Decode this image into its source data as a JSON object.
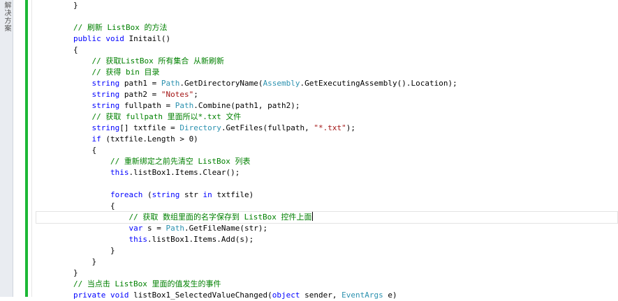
{
  "sidebar": {
    "label": "解决方案"
  },
  "colors": {
    "keyword": "#0000ff",
    "string": "#a31515",
    "comment": "#008000",
    "type": "#2b91af",
    "plain": "#000000",
    "change_bar": "#1cb836"
  },
  "editor": {
    "current_line": 19,
    "lines": [
      {
        "indent": "        ",
        "tokens": [
          [
            "plain",
            "}"
          ]
        ]
      },
      {
        "indent": "",
        "tokens": []
      },
      {
        "indent": "        ",
        "tokens": [
          [
            "cm",
            "// 刷新 ListBox 的方法"
          ]
        ]
      },
      {
        "indent": "        ",
        "tokens": [
          [
            "kw",
            "public"
          ],
          [
            "plain",
            " "
          ],
          [
            "kw",
            "void"
          ],
          [
            "plain",
            " Initail()"
          ]
        ]
      },
      {
        "indent": "        ",
        "tokens": [
          [
            "plain",
            "{"
          ]
        ]
      },
      {
        "indent": "            ",
        "tokens": [
          [
            "cm",
            "// 获取ListBox 所有集合 从新刷新"
          ]
        ]
      },
      {
        "indent": "            ",
        "tokens": [
          [
            "cm",
            "// 获得 bin 目录"
          ]
        ]
      },
      {
        "indent": "            ",
        "tokens": [
          [
            "kw",
            "string"
          ],
          [
            "plain",
            " path1 = "
          ],
          [
            "type",
            "Path"
          ],
          [
            "plain",
            ".GetDirectoryName("
          ],
          [
            "type",
            "Assembly"
          ],
          [
            "plain",
            ".GetExecutingAssembly().Location);"
          ]
        ]
      },
      {
        "indent": "            ",
        "tokens": [
          [
            "kw",
            "string"
          ],
          [
            "plain",
            " path2 = "
          ],
          [
            "str",
            "\"Notes\""
          ],
          [
            "plain",
            ";"
          ]
        ]
      },
      {
        "indent": "            ",
        "tokens": [
          [
            "kw",
            "string"
          ],
          [
            "plain",
            " fullpath = "
          ],
          [
            "type",
            "Path"
          ],
          [
            "plain",
            ".Combine(path1, path2);"
          ]
        ]
      },
      {
        "indent": "            ",
        "tokens": [
          [
            "cm",
            "// 获取 fullpath 里面所以*.txt 文件"
          ]
        ]
      },
      {
        "indent": "            ",
        "tokens": [
          [
            "kw",
            "string"
          ],
          [
            "plain",
            "[] txtfile = "
          ],
          [
            "type",
            "Directory"
          ],
          [
            "plain",
            ".GetFiles(fullpath, "
          ],
          [
            "str",
            "\"*.txt\""
          ],
          [
            "plain",
            ");"
          ]
        ]
      },
      {
        "indent": "            ",
        "tokens": [
          [
            "kw",
            "if"
          ],
          [
            "plain",
            " (txtfile.Length > 0)"
          ]
        ]
      },
      {
        "indent": "            ",
        "tokens": [
          [
            "plain",
            "{"
          ]
        ]
      },
      {
        "indent": "                ",
        "tokens": [
          [
            "cm",
            "// 重新绑定之前先清空 ListBox 列表"
          ]
        ]
      },
      {
        "indent": "                ",
        "tokens": [
          [
            "kw",
            "this"
          ],
          [
            "plain",
            ".listBox1.Items.Clear();"
          ]
        ]
      },
      {
        "indent": "",
        "tokens": []
      },
      {
        "indent": "                ",
        "tokens": [
          [
            "kw",
            "foreach"
          ],
          [
            "plain",
            " ("
          ],
          [
            "kw",
            "string"
          ],
          [
            "plain",
            " str "
          ],
          [
            "kw",
            "in"
          ],
          [
            "plain",
            " txtfile)"
          ]
        ]
      },
      {
        "indent": "                ",
        "tokens": [
          [
            "plain",
            "{"
          ]
        ]
      },
      {
        "indent": "                    ",
        "tokens": [
          [
            "cm",
            "// 获取 数组里面的名字保存到 ListBox 控件上面"
          ]
        ]
      },
      {
        "indent": "                    ",
        "tokens": [
          [
            "kw",
            "var"
          ],
          [
            "plain",
            " s = "
          ],
          [
            "type",
            "Path"
          ],
          [
            "plain",
            ".GetFileName(str);"
          ]
        ]
      },
      {
        "indent": "                    ",
        "tokens": [
          [
            "kw",
            "this"
          ],
          [
            "plain",
            ".listBox1.Items.Add(s);"
          ]
        ]
      },
      {
        "indent": "                ",
        "tokens": [
          [
            "plain",
            "}"
          ]
        ]
      },
      {
        "indent": "            ",
        "tokens": [
          [
            "plain",
            "}"
          ]
        ]
      },
      {
        "indent": "        ",
        "tokens": [
          [
            "plain",
            "}"
          ]
        ]
      },
      {
        "indent": "        ",
        "tokens": [
          [
            "cm",
            "// 当点击 ListBox 里面的值发生的事件"
          ]
        ]
      },
      {
        "indent": "        ",
        "tokens": [
          [
            "kw",
            "private"
          ],
          [
            "plain",
            " "
          ],
          [
            "kw",
            "void"
          ],
          [
            "plain",
            " listBox1_SelectedValueChanged("
          ],
          [
            "kw",
            "object"
          ],
          [
            "plain",
            " sender, "
          ],
          [
            "type",
            "EventArgs"
          ],
          [
            "plain",
            " e)"
          ]
        ]
      }
    ]
  }
}
